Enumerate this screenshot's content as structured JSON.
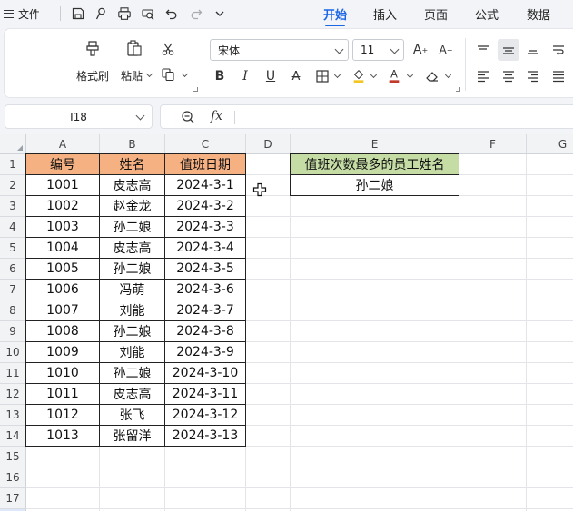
{
  "menu": {
    "file_label": "文件",
    "tabs": [
      {
        "label": "开始",
        "active": true
      },
      {
        "label": "插入",
        "active": false
      },
      {
        "label": "页面",
        "active": false
      },
      {
        "label": "公式",
        "active": false
      },
      {
        "label": "数据",
        "active": false
      }
    ],
    "quick_access_icons": [
      "save-icon",
      "format-brush-icon",
      "print-icon",
      "print-preview-icon",
      "undo-icon",
      "redo-icon",
      "more-chevron-icon"
    ]
  },
  "ribbon": {
    "format_painter_label": "格式刷",
    "paste_label": "粘贴",
    "font_name": "宋体",
    "font_size": "11",
    "bold": "B",
    "italic": "I",
    "underline": "U",
    "strike": "A",
    "font_color": "A",
    "font_color_value": "#c0392b",
    "fill_color_value": "#f3c623"
  },
  "formula_bar": {
    "name_box": "I18",
    "fx_label": "fx",
    "formula": ""
  },
  "grid": {
    "columns": [
      "A",
      "B",
      "C",
      "D",
      "E",
      "F",
      "G"
    ],
    "rows": [
      "1",
      "2",
      "3",
      "4",
      "5",
      "6",
      "7",
      "8",
      "9",
      "10",
      "11",
      "12",
      "13",
      "14",
      "15",
      "16",
      "17",
      "18"
    ],
    "selected_row": "18",
    "table_headers": [
      "编号",
      "姓名",
      "值班日期"
    ],
    "table_rows": [
      [
        "1001",
        "皮志高",
        "2024-3-1"
      ],
      [
        "1002",
        "赵金龙",
        "2024-3-2"
      ],
      [
        "1003",
        "孙二娘",
        "2024-3-3"
      ],
      [
        "1004",
        "皮志高",
        "2024-3-4"
      ],
      [
        "1005",
        "孙二娘",
        "2024-3-5"
      ],
      [
        "1006",
        "冯萌",
        "2024-3-6"
      ],
      [
        "1007",
        "刘能",
        "2024-3-7"
      ],
      [
        "1008",
        "孙二娘",
        "2024-3-8"
      ],
      [
        "1009",
        "刘能",
        "2024-3-9"
      ],
      [
        "1010",
        "孙二娘",
        "2024-3-10"
      ],
      [
        "1011",
        "皮志高",
        "2024-3-11"
      ],
      [
        "1012",
        "张飞",
        "2024-3-12"
      ],
      [
        "1013",
        "张留洋",
        "2024-3-13"
      ]
    ],
    "result_header": "值班次数最多的员工姓名",
    "result_value": "孙二娘",
    "header_fill": "#f6b183",
    "result_header_fill": "#c5dca5"
  }
}
